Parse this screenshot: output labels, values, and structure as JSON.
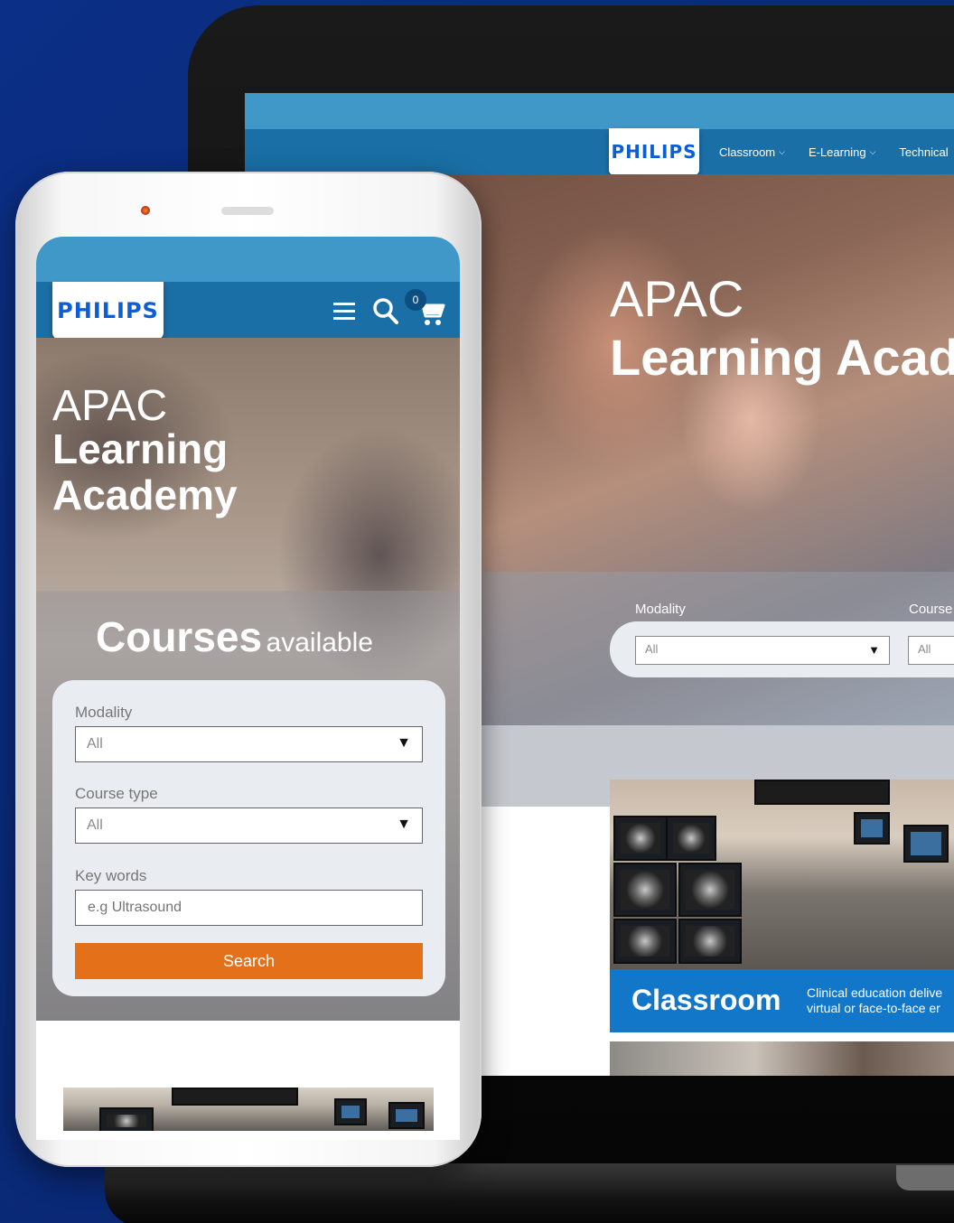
{
  "laptop": {
    "logo": "PHILIPS",
    "nav": [
      {
        "label": "Classroom",
        "chevron": true
      },
      {
        "label": "E-Learning",
        "chevron": true
      },
      {
        "label": "Technical",
        "chevron": false
      }
    ],
    "hero": {
      "line1": "APAC",
      "line2": "Learning Acad"
    },
    "filters": {
      "modality_label": "Modality",
      "modality_value": "All",
      "course_label": "Course",
      "course_value": "All"
    },
    "card": {
      "title": "Classroom",
      "desc_line1": "Clinical education delive",
      "desc_line2": "virtual or face-to-face er"
    }
  },
  "phone": {
    "logo": "PHILIPS",
    "cart_count": "0",
    "icons": [
      "menu-icon",
      "search-icon",
      "cart-icon"
    ],
    "hero": {
      "line1": "APAC",
      "line2": "Learning",
      "line3": "Academy"
    },
    "courses": {
      "bold": "Courses",
      "light": "available"
    },
    "form": {
      "modality_label": "Modality",
      "modality_value": "All",
      "course_type_label": "Course type",
      "course_type_value": "All",
      "keywords_label": "Key words",
      "keywords_placeholder": "e.g Ultrasound",
      "search_label": "Search"
    }
  },
  "colors": {
    "background": "#0b2f86",
    "nav_blue": "#1a6fa6",
    "top_blue": "#3f98c7",
    "logo_blue": "#0b5ed7",
    "search_orange": "#e4711a",
    "card_blue": "#1277c9"
  }
}
